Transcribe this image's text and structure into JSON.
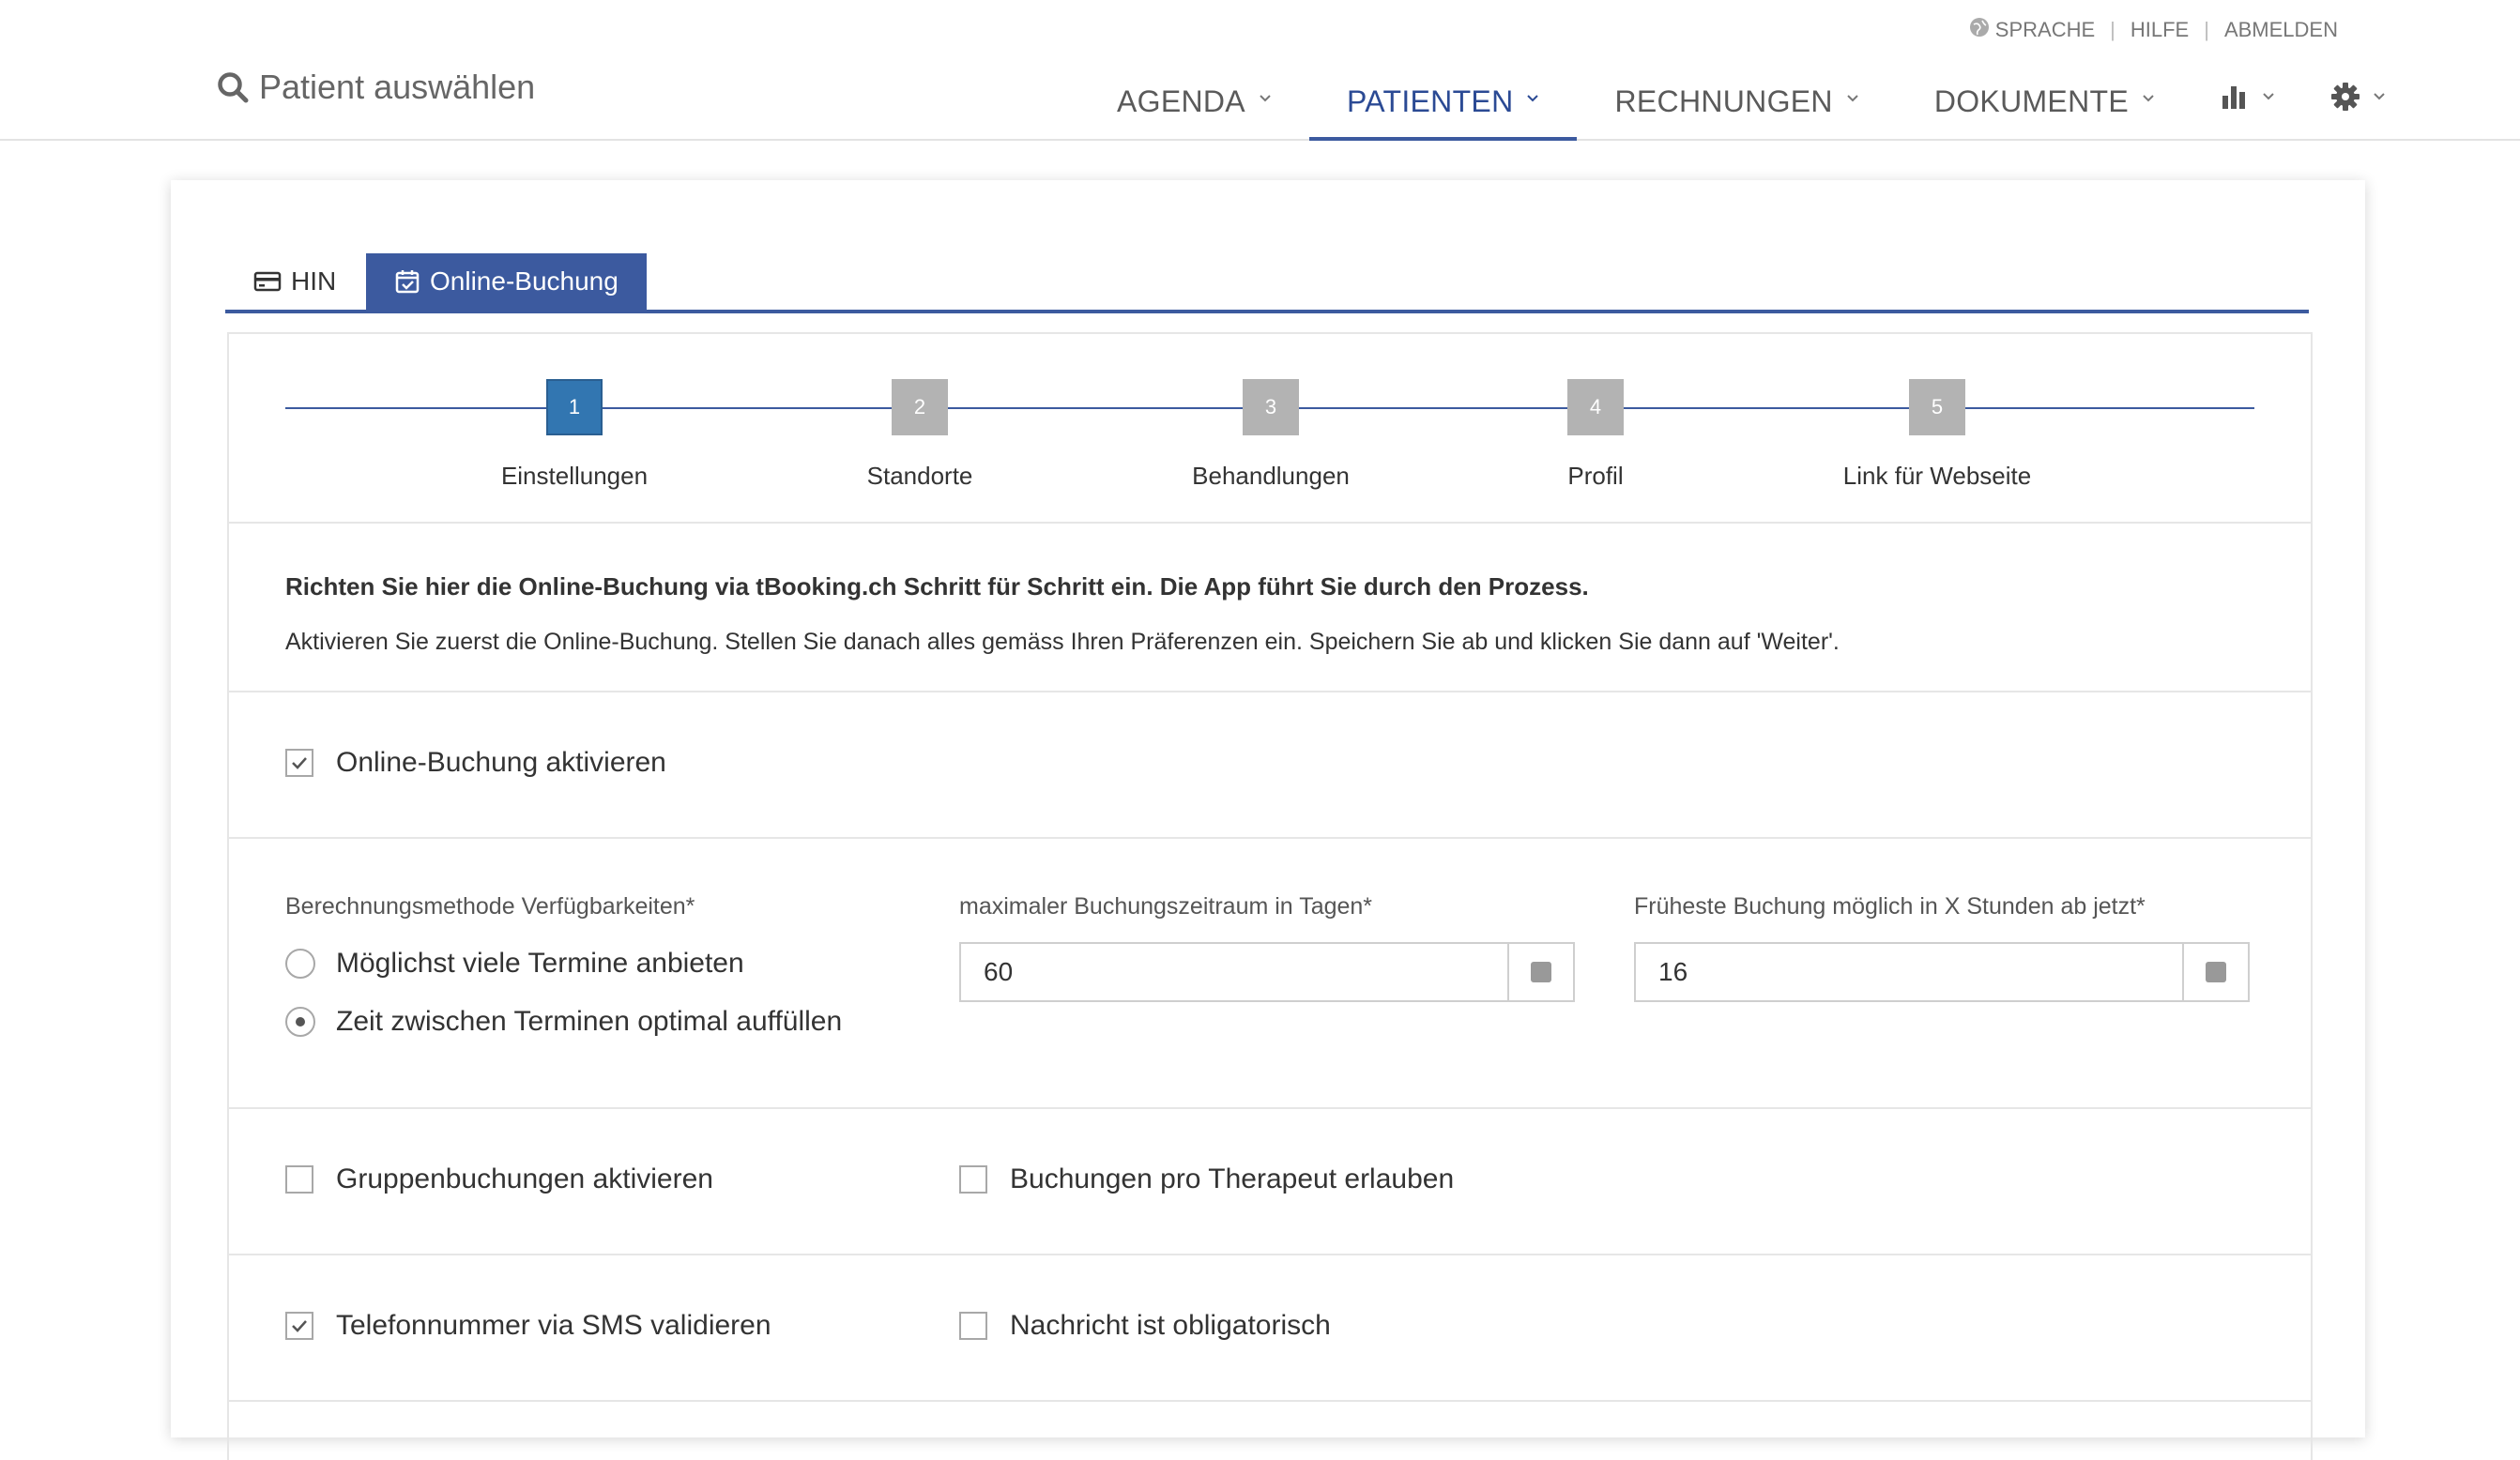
{
  "utility": {
    "language": "SPRACHE",
    "help": "HILFE",
    "logout": "ABMELDEN"
  },
  "patient_search": {
    "label": "Patient auswählen"
  },
  "nav": {
    "agenda": "AGENDA",
    "patients": "PATIENTEN",
    "invoices": "RECHNUNGEN",
    "documents": "DOKUMENTE",
    "stats_icon": "bar-chart-icon",
    "settings_icon": "gear-icon",
    "active": "PATIENTEN"
  },
  "tabs": {
    "hin": "HIN",
    "online_booking": "Online-Buchung"
  },
  "stepper": {
    "steps": [
      {
        "number": "1",
        "label": "Einstellungen",
        "active": true
      },
      {
        "number": "2",
        "label": "Standorte",
        "active": false
      },
      {
        "number": "3",
        "label": "Behandlungen",
        "active": false
      },
      {
        "number": "4",
        "label": "Profil",
        "active": false
      },
      {
        "number": "5",
        "label": "Link für Webseite",
        "active": false
      }
    ]
  },
  "intro": {
    "heading": "Richten Sie hier die Online-Buchung via tBooking.ch Schritt für Schritt ein. Die App führt Sie durch den Prozess.",
    "text": "Aktivieren Sie zuerst die Online-Buchung. Stellen Sie danach alles gemäss Ihren Präferenzen ein. Speichern Sie ab und klicken Sie dann auf 'Weiter'."
  },
  "settings": {
    "activate_online_booking": {
      "label": "Online-Buchung aktivieren",
      "checked": true
    },
    "calc_method": {
      "label": "Berechnungsmethode Verfügbarkeiten*",
      "options": [
        {
          "label": "Möglichst viele Termine anbieten",
          "selected": false
        },
        {
          "label": "Zeit zwischen Terminen optimal auffüllen",
          "selected": true
        }
      ]
    },
    "max_booking_days": {
      "label": "maximaler Buchungszeitraum in Tagen*",
      "value": "60"
    },
    "earliest_booking_hours": {
      "label": "Früheste Buchung möglich in X Stunden ab jetzt*",
      "value": "16"
    },
    "group_bookings": {
      "label": "Gruppenbuchungen aktivieren",
      "checked": false
    },
    "per_therapist": {
      "label": "Buchungen pro Therapeut erlauben",
      "checked": false
    },
    "sms_validation": {
      "label": "Telefonnummer via SMS validieren",
      "checked": true
    },
    "message_required": {
      "label": "Nachricht ist obligatorisch",
      "checked": false
    }
  },
  "colors": {
    "accent": "#3c5a9f",
    "step_active": "#3276b1",
    "step_inactive": "#b3b3b3"
  }
}
